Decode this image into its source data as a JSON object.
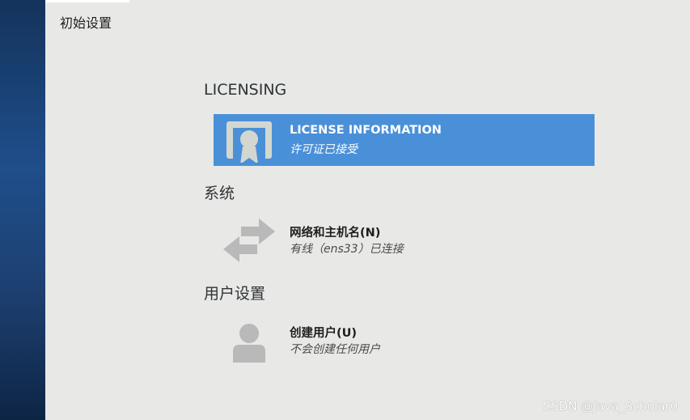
{
  "header": {
    "title": "初始设置"
  },
  "sections": [
    {
      "heading": "LICENSING",
      "spokes": [
        {
          "title": "LICENSE INFORMATION",
          "status": "许可证已接受",
          "icon": "certificate-icon"
        }
      ]
    },
    {
      "heading": "系统",
      "spokes": [
        {
          "title": "网络和主机名(N)",
          "status": "有线（ens33）已连接",
          "icon": "network-arrows-icon"
        }
      ]
    },
    {
      "heading": "用户设置",
      "spokes": [
        {
          "title": "创建用户(U)",
          "status": "不会创建任何用户",
          "icon": "user-icon"
        }
      ]
    }
  ],
  "watermark": "CSDN @Java_Scholar0",
  "colors": {
    "sidebar": "#1f4e8a",
    "selected": "#4a90d9",
    "background": "#e8e8e6"
  }
}
